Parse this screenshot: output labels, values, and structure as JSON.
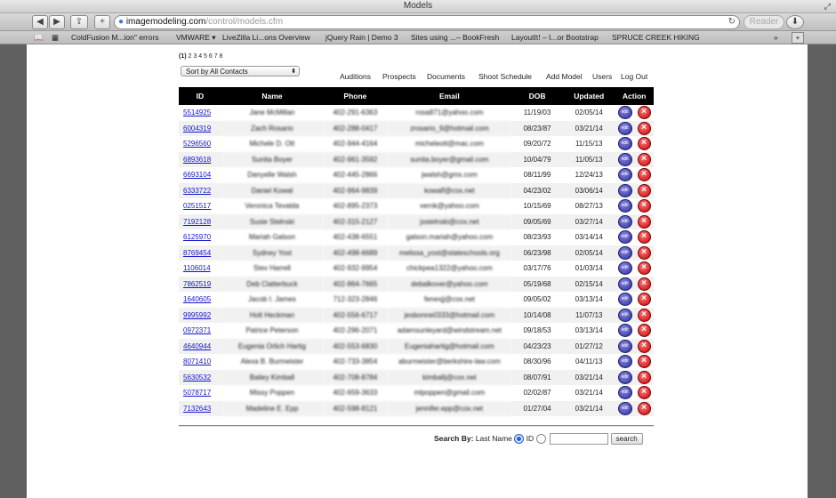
{
  "window": {
    "title": "Models"
  },
  "toolbar": {
    "url_host": "imagemodeling.com",
    "url_path": "/control/models.cfm",
    "reader_label": "Reader",
    "plus_label": "+"
  },
  "bookmarks": [
    "ColdFusion M...ion\" errors",
    "VMWARE ▾",
    "LiveZilla Li...ons Overview",
    "jQuery Rain | Demo 3",
    "Sites using ...– BookFresh",
    "LayoutIt! – I...or Bootstrap",
    "SPRUCE CREEK HIKING"
  ],
  "pager": {
    "current": "(1)",
    "pages": "2 3 4 5 6 7 8"
  },
  "sort": {
    "selected": "Sort by All Contacts"
  },
  "nav": [
    "Auditions",
    "Prospects",
    "Documents",
    "Shoot Schedule",
    "Add Model",
    "Users",
    "Log Out"
  ],
  "table": {
    "headers": [
      "ID",
      "Name",
      "Phone",
      "Email",
      "DOB",
      "Updated",
      "Action"
    ],
    "edit_label": "edit",
    "rows": [
      {
        "id": "5514925",
        "name": "Jane  McMillan",
        "phone": "402-291-6363",
        "email": "rosa871@yahoo.com",
        "dob": "11/19/03",
        "updated": "02/05/14"
      },
      {
        "id": "6004319",
        "name": "Zach Rosario",
        "phone": "402-288-0417",
        "email": "zrosario_9@hotmail.com",
        "dob": "08/23/87",
        "updated": "03/21/14"
      },
      {
        "id": "5296560",
        "name": "Michele D. Ott",
        "phone": "402-944-4164",
        "email": "micheleott@mac.com",
        "dob": "09/20/72",
        "updated": "11/15/13"
      },
      {
        "id": "6893618",
        "name": "Sunita Boyer",
        "phone": "402-961-3592",
        "email": "sunita.boyer@gmail.com",
        "dob": "10/04/79",
        "updated": "11/05/13"
      },
      {
        "id": "6693104",
        "name": "Danyelle Walsh",
        "phone": "402-445-2866",
        "email": "jwalsh@gmx.com",
        "dob": "08/11/99",
        "updated": "12/24/13"
      },
      {
        "id": "6333722",
        "name": "Daniel Kowal",
        "phone": "402-964-9839",
        "email": "kowalf@cox.net",
        "dob": "04/23/02",
        "updated": "03/06/14"
      },
      {
        "id": "0251517",
        "name": "Veronica Tevalda",
        "phone": "402-895-2373",
        "email": "vernk@yahoo.com",
        "dob": "10/15/69",
        "updated": "08/27/13"
      },
      {
        "id": "7192128",
        "name": "Susie Stelnski",
        "phone": "402-315-2127",
        "email": "jsstelnski@cox.net",
        "dob": "09/05/69",
        "updated": "03/27/14"
      },
      {
        "id": "6125970",
        "name": "Mariah Galson",
        "phone": "402-438-6551",
        "email": "galson.mariah@yahoo.com",
        "dob": "08/23/93",
        "updated": "03/14/14"
      },
      {
        "id": "8769454",
        "name": "Sydney  Yost",
        "phone": "402-498-6689",
        "email": "melissa_yost@stateschools.org",
        "dob": "06/23/98",
        "updated": "02/05/14"
      },
      {
        "id": "1106014",
        "name": "Stev Harrell",
        "phone": "402-932-9954",
        "email": "chickpea1322@yahoo.com",
        "dob": "03/17/76",
        "updated": "01/03/14"
      },
      {
        "id": "7862519",
        "name": "Deb Clatterbuck",
        "phone": "402-864-7665",
        "email": "debalkover@yahoo.com",
        "dob": "05/19/68",
        "updated": "02/15/14"
      },
      {
        "id": "1640605",
        "name": "Jacob I. James",
        "phone": "712-323-2846",
        "email": "fenexjj@cox.net",
        "dob": "09/05/02",
        "updated": "03/13/14"
      },
      {
        "id": "9995992",
        "name": "Holt Heckman",
        "phone": "402-556-6717",
        "email": "jesbonne0333@hotmail.com",
        "dob": "10/14/08",
        "updated": "11/07/13"
      },
      {
        "id": "0972371",
        "name": "Patrice Peterson",
        "phone": "402-296-2071",
        "email": "adamsunleyard@windstream.net",
        "dob": "09/18/53",
        "updated": "03/13/14"
      },
      {
        "id": "4640944",
        "name": "Eugenia Orlich Hartig",
        "phone": "402-553-6830",
        "email": "Eugeniahartig@hotmail.com",
        "dob": "04/23/23",
        "updated": "01/27/12"
      },
      {
        "id": "8071410",
        "name": "Alexa B. Burmeister",
        "phone": "402-733-3854",
        "email": "aburmeister@berkshire-law.com",
        "dob": "08/30/96",
        "updated": "04/11/13"
      },
      {
        "id": "5630532",
        "name": "Bailey Kimball",
        "phone": "402-708-8784",
        "email": "kimballj@cox.net",
        "dob": "08/07/91",
        "updated": "03/21/14"
      },
      {
        "id": "5078717",
        "name": "Missy Poppen",
        "phone": "402-659-3633",
        "email": "mlpoppen@gmail.com",
        "dob": "02/02/87",
        "updated": "03/21/14"
      },
      {
        "id": "7132643",
        "name": "Madeline E. Epp",
        "phone": "402-598-8121",
        "email": "jennifer.epp@cox.net",
        "dob": "01/27/04",
        "updated": "03/21/14"
      }
    ]
  },
  "search": {
    "label": "Search By:",
    "opt_lastname": "Last Name",
    "opt_id": "ID",
    "button": "search",
    "value": ""
  }
}
